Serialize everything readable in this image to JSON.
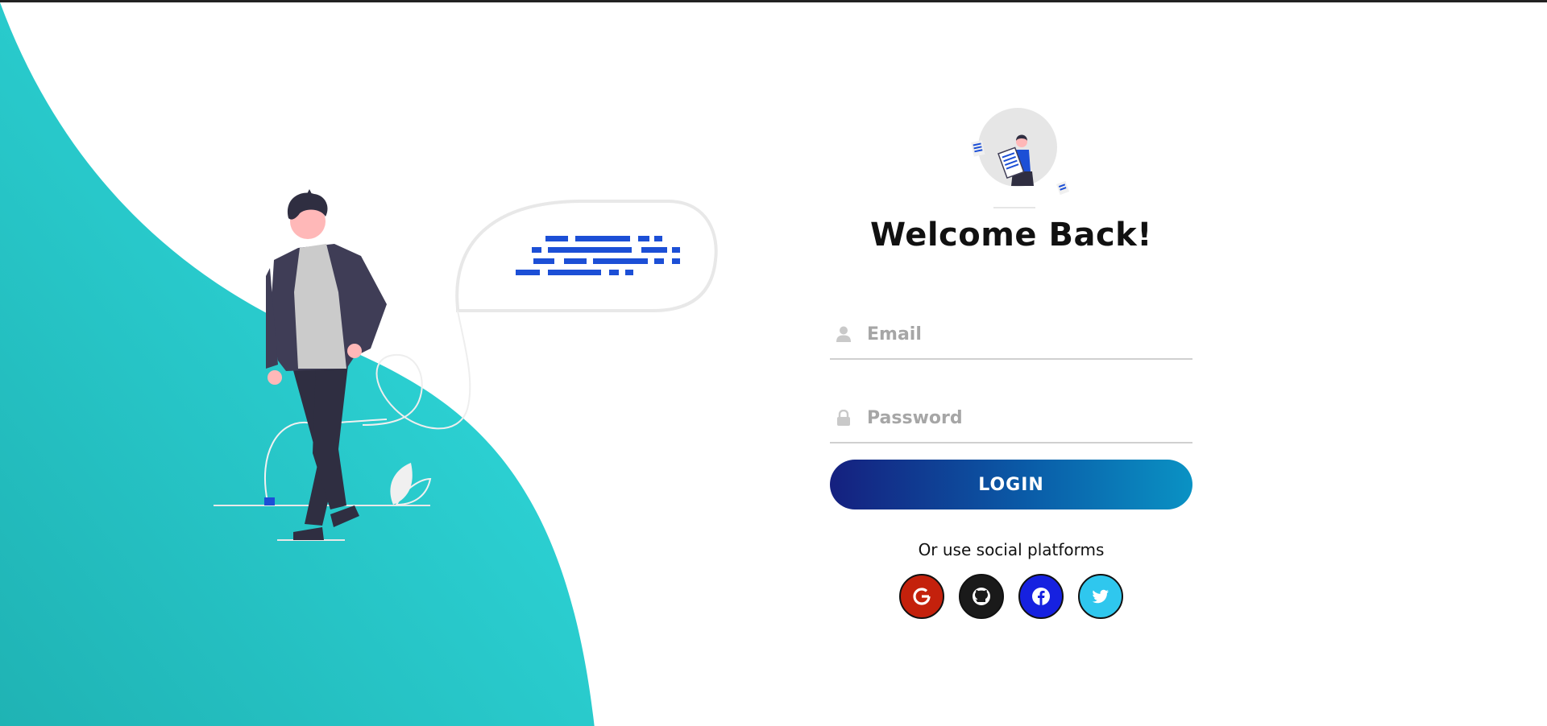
{
  "title": "Welcome Back!",
  "form": {
    "email_placeholder": "Email",
    "email_value": "",
    "password_placeholder": "Password",
    "password_value": "",
    "login_label": "LOGIN"
  },
  "social": {
    "text": "Or use social platforms",
    "buttons": [
      {
        "name": "google",
        "icon": "google-icon",
        "color": "#c4210c"
      },
      {
        "name": "github",
        "icon": "github-icon",
        "color": "#1a1a1a"
      },
      {
        "name": "facebook",
        "icon": "facebook-icon",
        "color": "#1621e0"
      },
      {
        "name": "twitter",
        "icon": "twitter-icon",
        "color": "#2fc7ee"
      }
    ]
  },
  "colors": {
    "accent_teal": "#2dd4d6",
    "button_start": "#15207f",
    "button_end": "#0a92c4",
    "illustration_blue": "#1c4fd6"
  }
}
